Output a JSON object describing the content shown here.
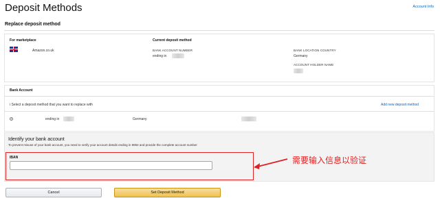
{
  "header": {
    "title": "Deposit Methods",
    "account_info": "Account Info"
  },
  "replace_section": {
    "title": "Replace deposit method",
    "for_marketplace_label": "For marketplace",
    "marketplace": "Amazon.co.uk",
    "current_method_label": "Current deposit method",
    "bank_account_number_label": "BANK ACCOUNT NUMBER",
    "ending_in": "ending in",
    "bank_location_label": "BANK LOCATION COUNTRY",
    "bank_location": "Germany",
    "account_holder_label": "ACCOUNT HOLDER NAME"
  },
  "bank_account": {
    "title": "Bank Account",
    "instruction": "Select a deposit method that you want to replace with",
    "add_link": "Add new deposit method",
    "row": {
      "ending_in": "ending in",
      "country": "Germany"
    }
  },
  "identify": {
    "title": "Identify your bank account",
    "description": "To prevent misuse of your bank account, you need to verify your account details ending in 8994 and provide the complete account number",
    "iban_label": "IBAN",
    "iban_value": ""
  },
  "annotation": {
    "text": "需要输入信息以验证",
    "color": "#e02020"
  },
  "buttons": {
    "cancel": "Cancel",
    "submit": "Set Deposit Method"
  }
}
